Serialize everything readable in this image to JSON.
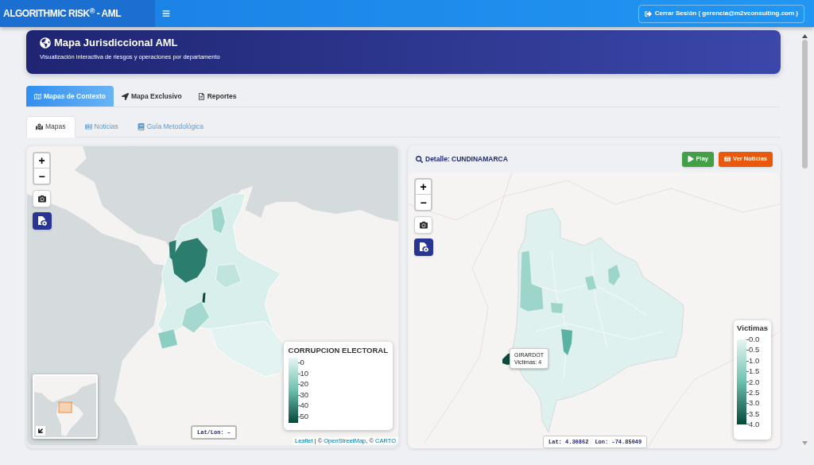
{
  "top_bar": {
    "brand": "ALGORITHMIC RISK$^{®}$ - AML",
    "logout_button": "Cerrar Sesión ( gerencia@m2vconsulting.com )"
  },
  "header": {
    "title": "Mapa Jurisdiccional AML",
    "subtitle": "Visualización interactiva de riesgos y operaciones por departamento"
  },
  "main_tabs": [
    {
      "label": "Mapas de Contexto",
      "selected": true
    },
    {
      "label": "Mapa Exclusivo",
      "selected": false
    },
    {
      "label": "Reportes",
      "selected": false
    }
  ],
  "sub_tabs": [
    {
      "label": "Mapas",
      "selected": true
    },
    {
      "label": "Noticias",
      "selected": false
    },
    {
      "label": "Guía Metodológica",
      "selected": false
    }
  ],
  "overview_map": {
    "zoom_in": "+",
    "zoom_out": "−",
    "legend": {
      "title": "CORRUPCION ELECTORAL",
      "ticks": [
        "0",
        "10",
        "20",
        "30",
        "40",
        "50"
      ]
    },
    "coordinates": "Lat/Lon: –",
    "attribution": [
      {
        "kind": "link",
        "text": "Leaflet"
      },
      {
        "kind": "text",
        "text": " | © "
      },
      {
        "kind": "link",
        "text": "OpenStreetMap"
      },
      {
        "kind": "text",
        "text": ", © "
      },
      {
        "kind": "link",
        "text": "CARTO"
      }
    ]
  },
  "detail_panel": {
    "title": "Detalle: CUNDINAMARCA",
    "buttons": [
      {
        "label": "Play",
        "kind": "play"
      },
      {
        "label": "Ver Noticias",
        "kind": "news"
      }
    ],
    "map": {
      "zoom_in": "+",
      "zoom_out": "−",
      "tooltip": {
        "title": "GIRARDOT",
        "text": "Victimas: 4"
      },
      "legend": {
        "title": "Victimas",
        "ticks": [
          "0.0",
          "0.5",
          "1.0",
          "1.5",
          "2.0",
          "2.5",
          "3.0",
          "3.5",
          "4.0"
        ]
      },
      "latitude": "Lat: 4.30862",
      "longitude": "Lon: -74.85049"
    }
  }
}
